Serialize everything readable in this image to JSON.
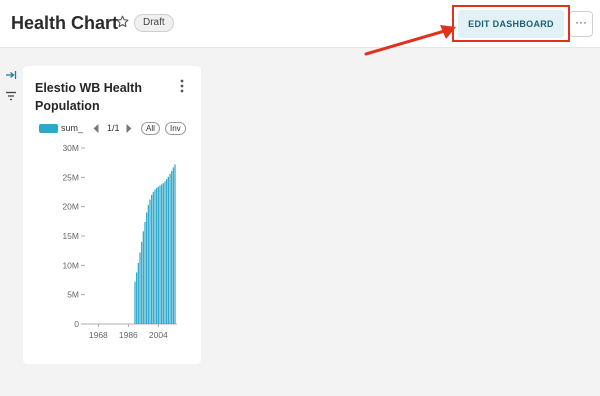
{
  "header": {
    "title": "Health Chart",
    "draft_label": "Draft",
    "edit_button_label": "EDIT DASHBOARD",
    "more_label": "···"
  },
  "card": {
    "title": "Elestio WB Health Population",
    "legend": {
      "label": "sum_",
      "page": "1/1",
      "all_label": "All",
      "inv_label": "Inv"
    }
  },
  "colors": {
    "accent": "#2ea8c9",
    "highlight": "#e0321e",
    "edit_button_bg": "#e2f1f5",
    "edit_button_text": "#1d5f73"
  },
  "chart_data": {
    "type": "bar",
    "series": [
      {
        "name": "sum_",
        "x": [
          1960,
          1961,
          1962,
          1963,
          1964,
          1965,
          1966,
          1967,
          1968,
          1969,
          1970,
          1971,
          1972,
          1973,
          1974,
          1975,
          1976,
          1977,
          1978,
          1979,
          1980,
          1981,
          1982,
          1983,
          1984,
          1985,
          1986,
          1987,
          1988,
          1989,
          1990,
          1991,
          1992,
          1993,
          1994,
          1995,
          1996,
          1997,
          1998,
          1999,
          2000,
          2001,
          2002,
          2003,
          2004,
          2005,
          2006,
          2007,
          2008,
          2009,
          2010,
          2011,
          2012,
          2013,
          2014
        ],
        "values": [
          0,
          0,
          0,
          0,
          0,
          0,
          0,
          0,
          0,
          0,
          0,
          0,
          0,
          0,
          0,
          0,
          0,
          0,
          0,
          0,
          0,
          0,
          0,
          0,
          0,
          0,
          0,
          0,
          0,
          0,
          7.2,
          8.8,
          10.4,
          12.2,
          14.0,
          15.8,
          17.4,
          19.0,
          20.3,
          21.2,
          22.0,
          22.5,
          22.9,
          23.2,
          23.4,
          23.6,
          23.8,
          24.0,
          24.3,
          24.7,
          25.1,
          25.6,
          26.1,
          26.7,
          27.2
        ]
      }
    ],
    "xticks": [
      "1968",
      "1986",
      "2004"
    ],
    "yticks": [
      "0",
      "5M",
      "10M",
      "15M",
      "20M",
      "25M",
      "30M"
    ],
    "ylim": [
      0,
      30
    ],
    "y_unit": "M",
    "grid": false
  }
}
